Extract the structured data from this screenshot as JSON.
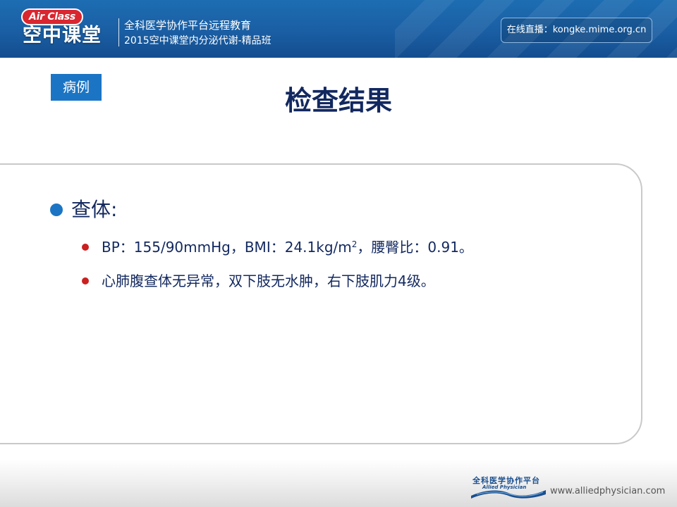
{
  "header": {
    "logo_en": "Air Class",
    "logo_cn": "空中课堂",
    "line1": "全科医学协作平台远程教育",
    "line2": "2015空中课堂内分泌代谢-精品班",
    "live_text": "在线直播：kongke.mime.org.cn"
  },
  "slide": {
    "tag": "病例",
    "title": "检查结果",
    "main_bullet": "查体:",
    "items": [
      {
        "before_sup": "BP：155/90mmHg，BMI：24.1kg/m",
        "sup": "2",
        "after_sup": "，腰臀比：0.91。"
      },
      {
        "text": "心肺腹查体无异常，双下肢无水肿，右下肢肌力4级。"
      }
    ]
  },
  "footer": {
    "logo_cn": "全科医学协作平台",
    "logo_en": "Allied Physician",
    "url": "www.alliedphysician.com"
  },
  "colors": {
    "header_blue": "#1a5ea3",
    "title_navy": "#12285f",
    "tag_blue": "#1b75c4",
    "bullet_red": "#cc1f1f"
  }
}
